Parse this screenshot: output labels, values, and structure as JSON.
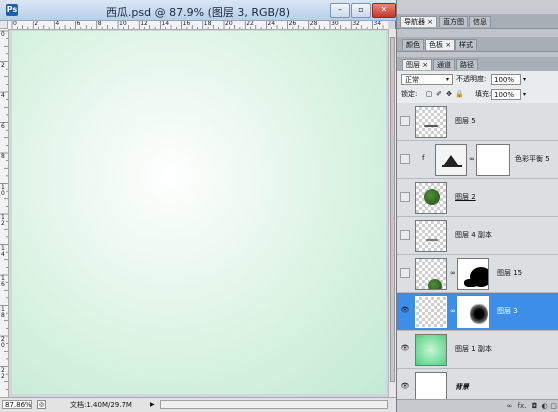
{
  "document": {
    "title": "西瓜.psd @ 87.9% (图层 3, RGB/8)",
    "app_icon": "Ps",
    "window_buttons": {
      "minimize": "–",
      "restore": "▫",
      "close": "✕"
    },
    "ruler_top_labels": [
      "0",
      "2",
      "4",
      "6",
      "8",
      "10",
      "12",
      "14",
      "16",
      "18",
      "20",
      "22",
      "24",
      "26",
      "28",
      "30",
      "32",
      "34"
    ],
    "ruler_left_labels": [
      "0",
      "2",
      "4",
      "6",
      "8",
      "1\n0",
      "1\n2",
      "1\n4",
      "1\n6",
      "1\n8",
      "2\n0",
      "2\n2"
    ],
    "canvas_colors": {
      "center": "#ffffff",
      "edge": "#c4ead3"
    }
  },
  "status_bar": {
    "zoom": "87.86%",
    "doc_info": "文档:1.40M/29.7M",
    "arrow": "▶"
  },
  "panel": {
    "top_tabs": [
      {
        "label": "导航器 ×",
        "active": true
      },
      {
        "label": "直方图",
        "active": false
      },
      {
        "label": "信息",
        "active": false
      }
    ],
    "mid_tabs": [
      {
        "label": "颜色",
        "active": false
      },
      {
        "label": "色板 ×",
        "active": true
      },
      {
        "label": "样式",
        "active": false
      }
    ],
    "layer_tabs": [
      {
        "label": "图层 ×",
        "active": true
      },
      {
        "label": "通道",
        "active": false
      },
      {
        "label": "路径",
        "active": false
      }
    ],
    "blend_mode": "正常",
    "opacity_label": "不透明度:",
    "opacity_value": "100%",
    "lock_label": "锁定:",
    "fill_label": "填充:",
    "fill_value": "100%",
    "caret": "▾"
  },
  "layers": [
    {
      "name": "图层 5",
      "visible": false,
      "thumb": "checker-line",
      "selected": false
    },
    {
      "name": "色彩平衡 5",
      "visible": false,
      "thumb": "balance",
      "selected": false
    },
    {
      "name": "图层 2",
      "visible": false,
      "thumb": "checker-ball",
      "selected": false
    },
    {
      "name": "图层 4 副本",
      "visible": false,
      "thumb": "checker-line",
      "selected": false
    },
    {
      "name": "图层 15",
      "visible": false,
      "thumb": "checker-ball-mask",
      "selected": false
    },
    {
      "name": "图层 3",
      "visible": true,
      "thumb": "checker-mask",
      "selected": true
    },
    {
      "name": "图层 1 副本",
      "visible": true,
      "thumb": "green",
      "selected": false
    },
    {
      "name": "背景",
      "visible": true,
      "thumb": "white",
      "selected": false
    }
  ],
  "panel_bottom_icons": [
    "link-icon",
    "fx-icon",
    "mask-icon",
    "adjustment-icon",
    "new-layer-icon"
  ],
  "panel_bottom_glyphs": [
    "∞",
    "fx.",
    "◘",
    "◐",
    "▢"
  ],
  "lock_glyphs": [
    "▢",
    "✐",
    "✥",
    "🔒"
  ],
  "chain_glyph": "∞",
  "eye_glyph": "👁",
  "fx_glyph": "f"
}
